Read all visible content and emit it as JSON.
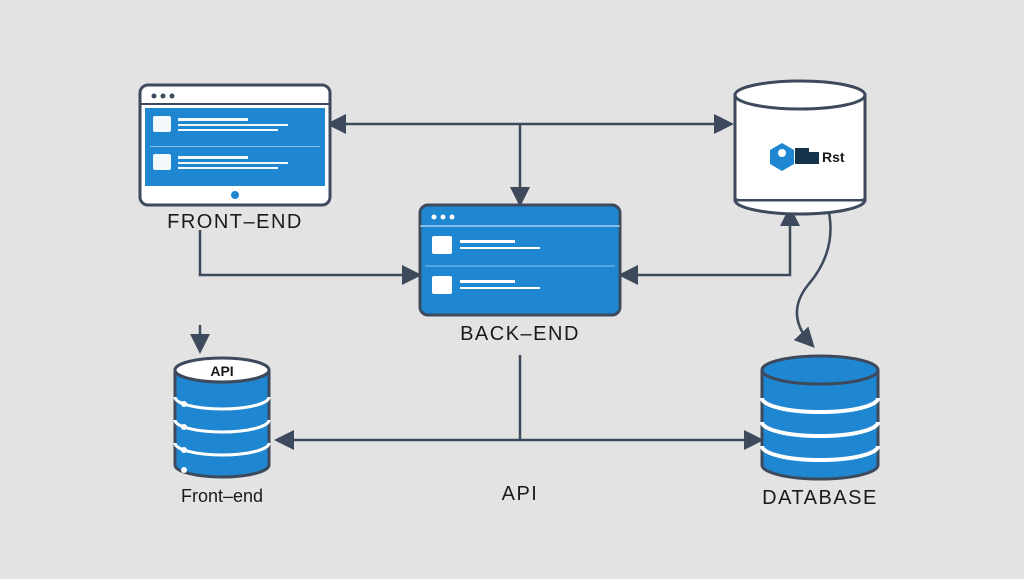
{
  "labels": {
    "frontend_top": "FRONT–END",
    "backend": "BACK–END",
    "database": "DATABASE",
    "api_bottom": "API",
    "frontend_bottom": "Front–end",
    "api_badge": "API",
    "rst_logo": "Rst"
  },
  "colors": {
    "primary": "#1f86d1",
    "stroke": "#3d4a5c",
    "bg": "#e3e3e3",
    "white": "#ffffff"
  },
  "nodes": [
    {
      "id": "frontend",
      "type": "browser",
      "label_key": "frontend_top"
    },
    {
      "id": "backend",
      "type": "server",
      "label_key": "backend"
    },
    {
      "id": "rst",
      "type": "cylinder-white",
      "label_key": "rst_logo"
    },
    {
      "id": "api",
      "type": "cylinder-stack",
      "label_key": "api_badge",
      "caption_key": "frontend_bottom"
    },
    {
      "id": "db",
      "type": "cylinder-stack",
      "caption_key": "database"
    }
  ],
  "connectors": [
    {
      "from": "frontend",
      "to": "rst",
      "dir": "both"
    },
    {
      "from": "frontend",
      "to": "backend",
      "dir": "to"
    },
    {
      "from": "rst",
      "to": "backend",
      "dir": "both"
    },
    {
      "from": "rst",
      "to": "db",
      "dir": "to"
    },
    {
      "from": "backend",
      "to": "api",
      "dir": "both"
    },
    {
      "from": "backend",
      "to": "db",
      "dir": "both"
    },
    {
      "from": "top-bus",
      "to": "backend",
      "dir": "to"
    }
  ]
}
